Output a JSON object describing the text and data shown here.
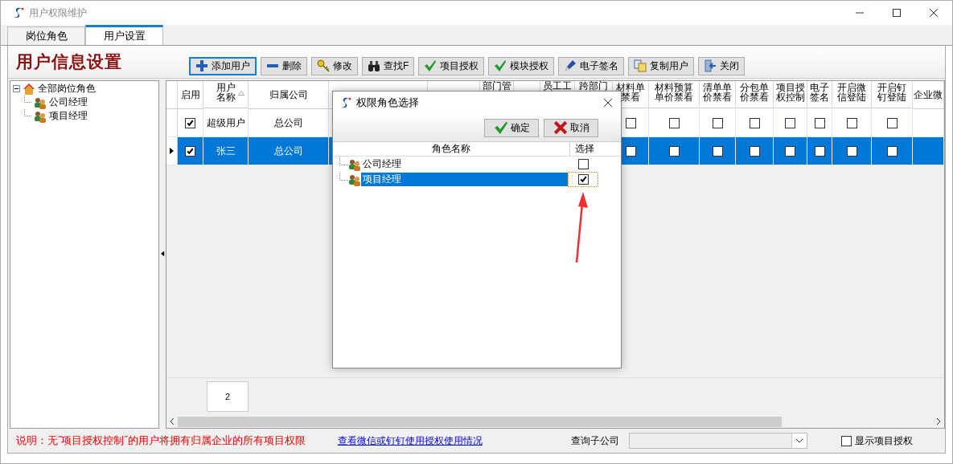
{
  "window": {
    "title": "用户权限维护"
  },
  "tabs": [
    {
      "label": "岗位角色",
      "selected": false
    },
    {
      "label": "用户设置",
      "selected": true
    }
  ],
  "page_title": "用户信息设置",
  "toolbar": [
    {
      "label": "添加用户",
      "kind": "add",
      "focused": true
    },
    {
      "label": "删除",
      "kind": "delete",
      "focused": false
    },
    {
      "label": "修改",
      "kind": "edit",
      "focused": false
    },
    {
      "label": "查找F",
      "kind": "find",
      "focused": false
    },
    {
      "label": "项目授权",
      "kind": "check",
      "focused": false
    },
    {
      "label": "模块授权",
      "kind": "check",
      "focused": false
    },
    {
      "label": "电子签名",
      "kind": "pen",
      "focused": false
    },
    {
      "label": "复制用户",
      "kind": "copy",
      "focused": false
    },
    {
      "label": "关闭",
      "kind": "exit",
      "focused": false
    }
  ],
  "tree": {
    "label": "全部岗位角色",
    "expanded": true,
    "children": [
      {
        "label": "公司经理"
      },
      {
        "label": "项目经理"
      }
    ]
  },
  "grid": {
    "columns": [
      {
        "lines": [
          "启用"
        ],
        "fragment": false
      },
      {
        "lines": [
          "用户",
          "名称"
        ],
        "sortable": true,
        "fragment": false
      },
      {
        "lines": [
          "归属公司"
        ],
        "fragment": false
      },
      {
        "lines": [
          "部门管"
        ],
        "fragment": true
      },
      {
        "lines": [
          "员工工"
        ],
        "fragment": true
      },
      {
        "lines": [
          "跨部门"
        ],
        "fragment": true
      },
      {
        "lines": [
          "材料单",
          "禁看"
        ],
        "fragment": false
      },
      {
        "lines": [
          "材料预算",
          "单价禁看"
        ],
        "fragment": false
      },
      {
        "lines": [
          "清单单",
          "价禁看"
        ],
        "fragment": false
      },
      {
        "lines": [
          "分包单",
          "价禁看"
        ],
        "fragment": false
      },
      {
        "lines": [
          "项目授",
          "权控制"
        ],
        "fragment": false
      },
      {
        "lines": [
          "电子",
          "签名"
        ],
        "fragment": false
      },
      {
        "lines": [
          "开启微",
          "信登陆"
        ],
        "fragment": false
      },
      {
        "lines": [
          "开启钉",
          "钉登陆"
        ],
        "fragment": false
      },
      {
        "lines": [
          "企业微"
        ],
        "fragment": false
      }
    ],
    "rows": [
      {
        "selected": false,
        "enabled": true,
        "user": "超级用户",
        "company": "总公司",
        "flags": [
          false,
          false,
          false,
          false,
          false,
          false,
          false,
          false
        ]
      },
      {
        "selected": true,
        "enabled": true,
        "user": "张三",
        "company": "总公司",
        "flags": [
          false,
          false,
          false,
          false,
          false,
          false,
          false,
          false
        ]
      }
    ],
    "footer_cell": "2"
  },
  "note": "说明：无˝项目授权控制˝的用户将拥有归属企业的所有项目权限",
  "link": "查看微信或钉钉使用授权使用情况",
  "filter_label": "查询子公司",
  "show_project_auth": {
    "label": "显示项目授权",
    "checked": false
  },
  "dialog": {
    "title": "权限角色选择",
    "buttons": [
      {
        "label": "确定",
        "kind": "ok"
      },
      {
        "label": "取消",
        "kind": "cancel"
      }
    ],
    "columns": [
      "角色名称",
      "选择"
    ],
    "roles": [
      {
        "name": "公司经理",
        "checked": false,
        "selected": false
      },
      {
        "name": "项目经理",
        "checked": true,
        "selected": true
      }
    ]
  }
}
